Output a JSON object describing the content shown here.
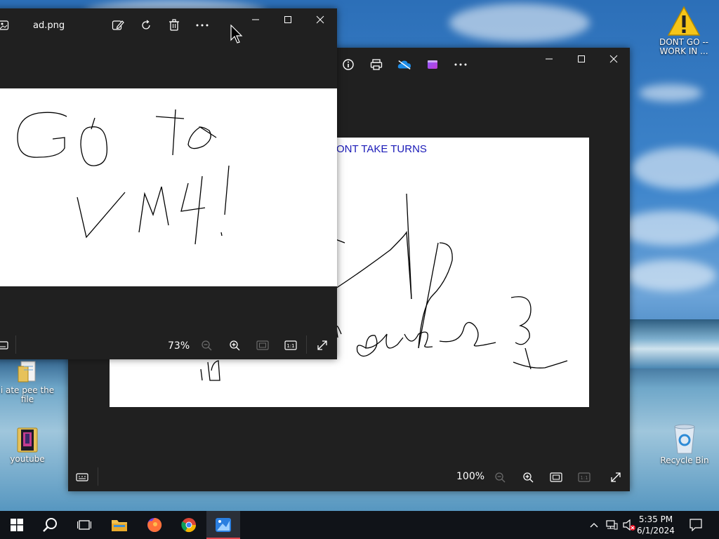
{
  "desktop": {
    "icons": [
      {
        "label": "DONT GO -- WORK IN ..."
      },
      {
        "label": "i ate pee the file"
      },
      {
        "label": "youtube"
      },
      {
        "label": "Recycle Bin"
      }
    ]
  },
  "front_window": {
    "title": "ad.png",
    "zoom": "73%",
    "handwriting": "GO TO VMY!"
  },
  "back_window": {
    "zoom": "100%",
    "image_text": "ONT TAKE TURNS"
  },
  "taskbar": {
    "time": "5:35 PM",
    "date": "6/1/2024"
  },
  "colors": {
    "window_bg": "#202020",
    "image_text_blue": "#1a1ab8",
    "taskbar_bg": "#101318",
    "active_underline": "#e0464e"
  }
}
